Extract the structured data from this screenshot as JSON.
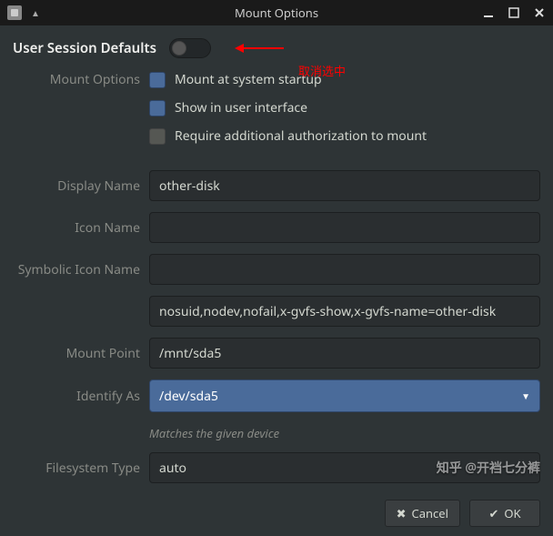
{
  "titlebar": {
    "title": "Mount Options"
  },
  "usd": {
    "label": "User Session Defaults",
    "annotation": "取消选中"
  },
  "labels": {
    "mount_options": "Mount Options",
    "display_name": "Display Name",
    "icon_name": "Icon Name",
    "symbolic_icon_name": "Symbolic Icon Name",
    "mount_point": "Mount Point",
    "identify_as": "Identify As",
    "filesystem_type": "Filesystem Type"
  },
  "checks": {
    "startup": "Mount at system startup",
    "show_ui": "Show in user interface",
    "require_auth": "Require additional authorization to mount"
  },
  "values": {
    "display_name": "other-disk",
    "icon_name": "",
    "symbolic_icon_name": "",
    "options_string": "nosuid,nodev,nofail,x-gvfs-show,x-gvfs-name=other-disk",
    "mount_point": "/mnt/sda5",
    "identify_as": "/dev/sda5",
    "identify_helper": "Matches the given device",
    "filesystem_type": "auto"
  },
  "buttons": {
    "cancel": "Cancel",
    "ok": "OK"
  },
  "watermark": "知乎 @开裆七分裤"
}
